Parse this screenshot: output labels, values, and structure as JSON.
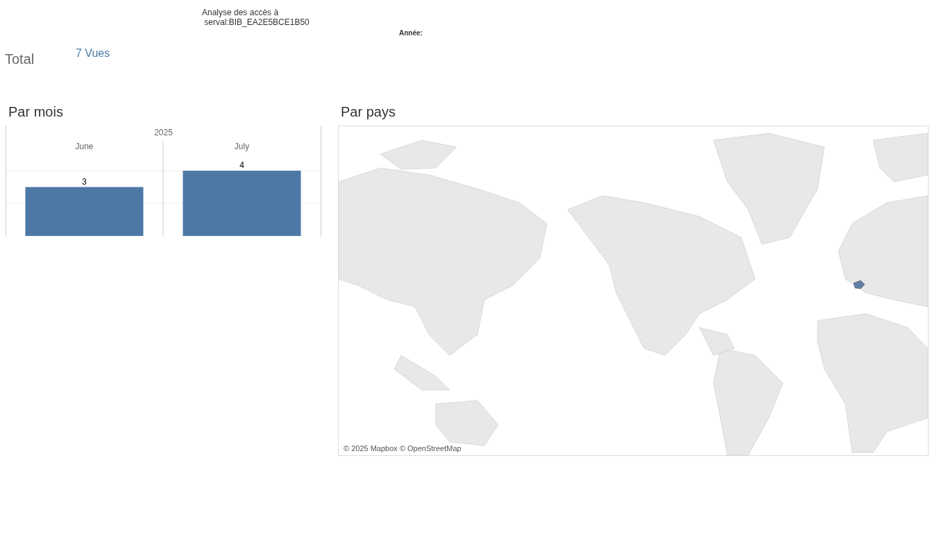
{
  "header": {
    "title": "Analyse des accès à\n serval:BIB_EA2E5BCE1B50",
    "filter_label": "Année:"
  },
  "total": {
    "label": "Total",
    "value": "7 Vues"
  },
  "by_month": {
    "heading": "Par mois",
    "column_header": "2025",
    "chart_data": {
      "type": "bar",
      "categories": [
        "June",
        "July"
      ],
      "series": [
        {
          "color": "#4e79a7",
          "values": [
            3,
            4
          ]
        }
      ],
      "ref_lines": [
        {
          "axis": "y",
          "value": 2
        }
      ],
      "data_labels": true
    }
  },
  "by_country": {
    "heading": "Par pays",
    "attribution": "© 2025 Mapbox © OpenStreetMap"
  }
}
